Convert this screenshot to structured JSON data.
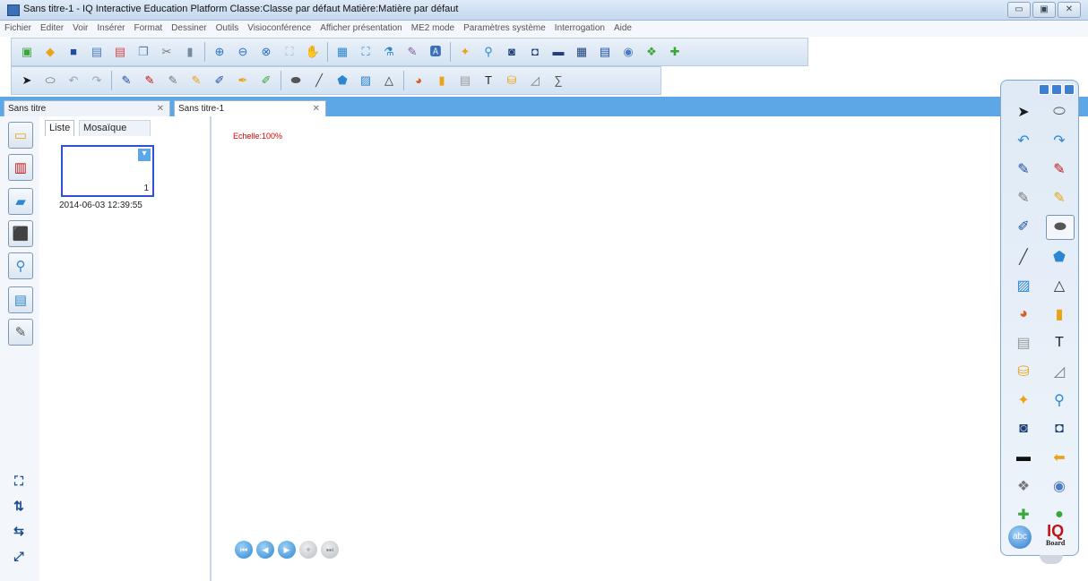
{
  "window": {
    "title": "Sans titre-1 - IQ Interactive Education Platform  Classe:Classe par défaut  Matière:Matière par défaut",
    "minimize": "▭",
    "maximize": "▣",
    "close": "✕"
  },
  "menu": [
    "Fichier",
    "Editer",
    "Voir",
    "Insérer",
    "Format",
    "Dessiner",
    "Outils",
    "Visioconférence",
    "Afficher présentation",
    "ME2 mode",
    "Paramètres système",
    "Interrogation",
    "Aide"
  ],
  "toolbar1": [
    {
      "name": "new-page-icon",
      "glyph": "▣",
      "color": "#3aa63a"
    },
    {
      "name": "open-icon",
      "glyph": "◆",
      "color": "#e8a317"
    },
    {
      "name": "save-icon",
      "glyph": "■",
      "color": "#1d4fa3"
    },
    {
      "name": "save-as-icon",
      "glyph": "▤",
      "color": "#4d7cc2"
    },
    {
      "name": "delete-page-icon",
      "glyph": "▤",
      "color": "#d24a4a"
    },
    {
      "name": "copy-icon",
      "glyph": "❐",
      "color": "#5c7ea8"
    },
    {
      "name": "cut-icon",
      "glyph": "✂",
      "color": "#777777"
    },
    {
      "name": "paste-icon",
      "glyph": "▮",
      "color": "#7a8aa0"
    },
    {
      "sep": true
    },
    {
      "name": "zoom-in-icon",
      "glyph": "⊕",
      "color": "#2a6fc9"
    },
    {
      "name": "zoom-out-icon",
      "glyph": "⊖",
      "color": "#2a6fc9"
    },
    {
      "name": "zoom-dropdown-icon",
      "glyph": "⊗",
      "color": "#2a6fc9"
    },
    {
      "name": "fit-icon",
      "glyph": "⛶",
      "color": "#9fb7d4"
    },
    {
      "name": "hand-pan-icon",
      "glyph": "✋",
      "color": "#3b6fb6"
    },
    {
      "sep": true
    },
    {
      "name": "screen-capture-icon",
      "glyph": "▦",
      "color": "#2c86d1"
    },
    {
      "name": "fullscreen-icon",
      "glyph": "⛶",
      "color": "#2c86d1"
    },
    {
      "name": "test-tubes-icon",
      "glyph": "⚗",
      "color": "#2c86d1"
    },
    {
      "name": "pen-settings-icon",
      "glyph": "✎",
      "color": "#7a5aa0"
    },
    {
      "name": "text-recognition-icon",
      "glyph": "🅰",
      "color": "#3b6fb6"
    },
    {
      "sep": true
    },
    {
      "name": "magic-icon",
      "glyph": "✦",
      "color": "#e8a317"
    },
    {
      "name": "magnifier-icon",
      "glyph": "⚲",
      "color": "#2c86d1"
    },
    {
      "name": "spotlight-icon",
      "glyph": "◙",
      "color": "#1d3f7a"
    },
    {
      "name": "curtain-icon",
      "glyph": "◘",
      "color": "#1d3f7a"
    },
    {
      "name": "black-screen-icon",
      "glyph": "▬",
      "color": "#1d3f7a"
    },
    {
      "name": "grid-icon",
      "glyph": "▦",
      "color": "#1d3f7a"
    },
    {
      "name": "board-icon",
      "glyph": "▤",
      "color": "#1d4fa3"
    },
    {
      "name": "camera-icon",
      "glyph": "◉",
      "color": "#4d7cc2"
    },
    {
      "name": "tools-icon",
      "glyph": "❖",
      "color": "#3aa63a"
    },
    {
      "name": "puzzle-icon",
      "glyph": "✚",
      "color": "#3aa63a"
    }
  ],
  "toolbar2": [
    {
      "name": "select-arrow-icon",
      "glyph": "➤",
      "color": "#1a1a1a"
    },
    {
      "name": "mouse-icon",
      "glyph": "⬭",
      "color": "#555555"
    },
    {
      "name": "undo-icon",
      "glyph": "↶",
      "color": "#8fa3bb"
    },
    {
      "name": "redo-icon",
      "glyph": "↷",
      "color": "#8fa3bb"
    },
    {
      "sep": true
    },
    {
      "name": "pen-blue-icon",
      "glyph": "✎",
      "color": "#1d4fa3"
    },
    {
      "name": "pen-red-icon",
      "glyph": "✎",
      "color": "#c21414"
    },
    {
      "name": "pen-grey-icon",
      "glyph": "✎",
      "color": "#777777"
    },
    {
      "name": "highlighter-icon",
      "glyph": "✎",
      "color": "#e8a317"
    },
    {
      "name": "brush-icon",
      "glyph": "✐",
      "color": "#1d4fa3"
    },
    {
      "name": "calligraphy-icon",
      "glyph": "✒",
      "color": "#e8a317"
    },
    {
      "name": "smart-pen-icon",
      "glyph": "✐",
      "color": "#3aa63a"
    },
    {
      "sep": true
    },
    {
      "name": "eraser-icon",
      "glyph": "⬬",
      "color": "#555555"
    },
    {
      "name": "line-icon",
      "glyph": "╱",
      "color": "#444444"
    },
    {
      "name": "shape-icon",
      "glyph": "⬟",
      "color": "#2c86d1"
    },
    {
      "name": "graph-icon",
      "glyph": "▨",
      "color": "#2c86d1"
    },
    {
      "name": "triangle-icon",
      "glyph": "△",
      "color": "#333333"
    },
    {
      "sep": true
    },
    {
      "name": "pie-chart-icon",
      "glyph": "◕",
      "color": "#d85a20"
    },
    {
      "name": "bar-chart-icon",
      "glyph": "▮",
      "color": "#e8a317"
    },
    {
      "name": "table-icon",
      "glyph": "▤",
      "color": "#999999"
    },
    {
      "name": "text-icon",
      "glyph": "T",
      "color": "#222222"
    },
    {
      "name": "fill-icon",
      "glyph": "⛁",
      "color": "#e8a317"
    },
    {
      "name": "ruler-icon",
      "glyph": "◿",
      "color": "#7a7a7a"
    },
    {
      "name": "formula-icon",
      "glyph": "∑",
      "color": "#555555"
    }
  ],
  "tabs": [
    {
      "label": "Sans titre",
      "close": "✕"
    },
    {
      "label": "Sans titre-1",
      "close": "✕"
    }
  ],
  "sidebar": [
    {
      "name": "page-list-icon",
      "glyph": "▭",
      "color": "#e8a317"
    },
    {
      "name": "library-icon",
      "glyph": "▥",
      "color": "#c21414"
    },
    {
      "name": "folder-icon",
      "glyph": "▰",
      "color": "#2c86d1"
    },
    {
      "name": "subject-tools-icon",
      "glyph": "⬛",
      "color": "#e8a317"
    },
    {
      "name": "search-resources-icon",
      "glyph": "⚲",
      "color": "#2c86d1"
    },
    {
      "name": "book-icon",
      "glyph": "▤",
      "color": "#2c86d1"
    },
    {
      "name": "notes-icon",
      "glyph": "✎",
      "color": "#555555"
    }
  ],
  "sidebar_bottom": [
    {
      "name": "fullscreen-panel-icon",
      "glyph": "⛶"
    },
    {
      "name": "sort-icon",
      "glyph": "⇅"
    },
    {
      "name": "swap-icon",
      "glyph": "⇆"
    },
    {
      "name": "collapse-icon",
      "glyph": "⤢"
    }
  ],
  "page_panel": {
    "tabs": [
      "Liste",
      "Mosaïque"
    ],
    "thumb_menu": "▾",
    "thumb_number": "1",
    "thumb_date": "2014-06-03 12:39:55"
  },
  "canvas": {
    "scale_label": "Echelle:100%"
  },
  "nav_buttons": [
    {
      "name": "first-page-button",
      "glyph": "⏮",
      "state": "on"
    },
    {
      "name": "prev-page-button",
      "glyph": "◀",
      "state": "on"
    },
    {
      "name": "next-page-button",
      "glyph": "▶",
      "state": "on"
    },
    {
      "name": "add-page-button",
      "glyph": "+",
      "state": "off"
    },
    {
      "name": "last-page-button",
      "glyph": "⏭",
      "state": "off"
    }
  ],
  "toolbox": [
    {
      "name": "select-arrow-icon",
      "glyph": "➤",
      "color": "#1a1a1a"
    },
    {
      "name": "mouse-icon",
      "glyph": "⬭",
      "color": "#555555"
    },
    {
      "name": "undo-icon",
      "glyph": "↶",
      "color": "#2c86d1"
    },
    {
      "name": "redo-icon",
      "glyph": "↷",
      "color": "#2c86d1"
    },
    {
      "name": "pen-blue-icon",
      "glyph": "✎",
      "color": "#1d4fa3"
    },
    {
      "name": "pen-red-icon",
      "glyph": "✎",
      "color": "#c21414"
    },
    {
      "name": "pen-grey-icon",
      "glyph": "✎",
      "color": "#777777"
    },
    {
      "name": "highlighter-icon",
      "glyph": "✎",
      "color": "#e8a317"
    },
    {
      "name": "brush-icon",
      "glyph": "✐",
      "color": "#1d4fa3"
    },
    {
      "name": "eraser-icon",
      "glyph": "⬬",
      "color": "#555555",
      "selected": true
    },
    {
      "name": "line-icon",
      "glyph": "╱",
      "color": "#444444"
    },
    {
      "name": "shape-icon",
      "glyph": "⬟",
      "color": "#2c86d1"
    },
    {
      "name": "graph-icon",
      "glyph": "▨",
      "color": "#2c86d1"
    },
    {
      "name": "triangle-icon",
      "glyph": "△",
      "color": "#333333"
    },
    {
      "name": "pie-chart-icon",
      "glyph": "◕",
      "color": "#d85a20"
    },
    {
      "name": "bar-chart-icon",
      "glyph": "▮",
      "color": "#e8a317"
    },
    {
      "name": "table-icon",
      "glyph": "▤",
      "color": "#999999"
    },
    {
      "name": "text-icon",
      "glyph": "T",
      "color": "#222222"
    },
    {
      "name": "fill-icon",
      "glyph": "⛁",
      "color": "#e8a317"
    },
    {
      "name": "ruler-icon",
      "glyph": "◿",
      "color": "#7a7a7a"
    },
    {
      "name": "magic-icon",
      "glyph": "✦",
      "color": "#e8a317"
    },
    {
      "name": "magnifier-icon",
      "glyph": "⚲",
      "color": "#2c86d1"
    },
    {
      "name": "spotlight-icon",
      "glyph": "◙",
      "color": "#1d3f7a"
    },
    {
      "name": "curtain-icon",
      "glyph": "◘",
      "color": "#1d3f7a"
    },
    {
      "name": "black-screen-icon",
      "glyph": "▬",
      "color": "#111111"
    },
    {
      "name": "back-arrow-icon",
      "glyph": "⬅",
      "color": "#e8a317"
    },
    {
      "name": "tools-icon",
      "glyph": "❖",
      "color": "#777777"
    },
    {
      "name": "camera-icon",
      "glyph": "◉",
      "color": "#4d7cc2"
    },
    {
      "name": "puzzle-icon",
      "glyph": "✚",
      "color": "#3aa63a"
    },
    {
      "name": "recorder-icon",
      "glyph": "●",
      "color": "#3aa63a"
    }
  ],
  "toolbox_footer": {
    "abc_label": "abc",
    "logo_main": "IQ",
    "logo_sub": "Board"
  }
}
